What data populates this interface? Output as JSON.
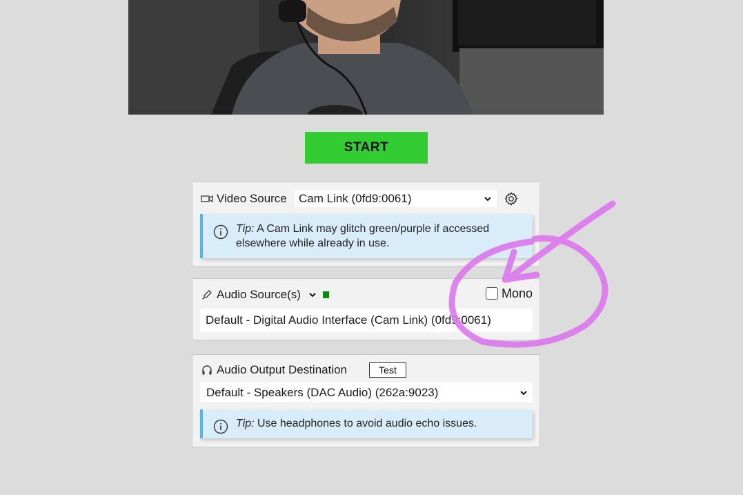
{
  "start_button": {
    "label": "START"
  },
  "video": {
    "label": "Video Source",
    "selected": "Cam Link (0fd9:0061)",
    "tip_prefix": "Tip:",
    "tip_text": " A Cam Link may glitch green/purple if accessed elsewhere while already in use."
  },
  "audio": {
    "label": "Audio Source(s)",
    "mono_label": "Mono",
    "mono_checked": false,
    "selected": "Default - Digital Audio Interface (Cam Link) (0fd9:0061)",
    "level_color": "#0a8a0a"
  },
  "output": {
    "label": "Audio Output Destination",
    "test_label": "Test",
    "selected": "Default - Speakers (DAC Audio) (262a:9023)",
    "tip_prefix": "Tip:",
    "tip_text": " Use headphones to avoid audio echo issues."
  },
  "colors": {
    "start": "#33cc33",
    "tip_bg": "#d9ecf9",
    "tip_border": "#4fb6e6",
    "annotation": "#dd77ee"
  },
  "icons": {
    "video": "video-camera-icon",
    "settings": "gear-icon",
    "info": "info-icon",
    "audio": "microphone-icon",
    "output": "headphones-icon",
    "dropdown": "chevron-down-icon"
  }
}
